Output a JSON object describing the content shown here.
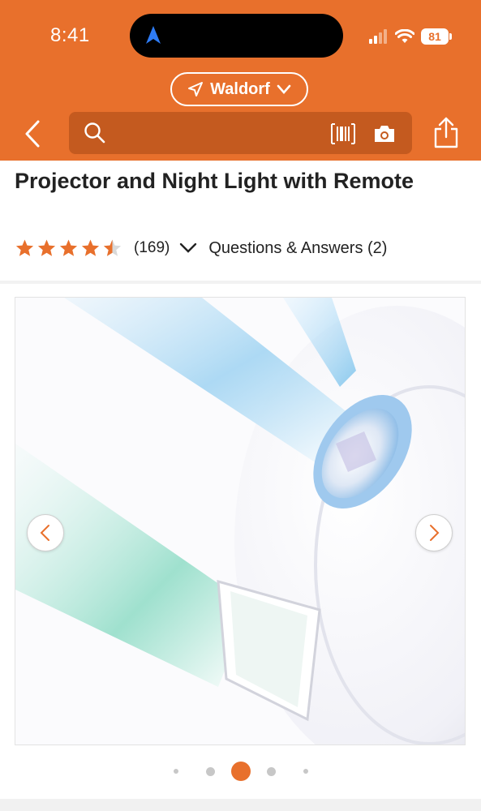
{
  "status_bar": {
    "time": "8:41",
    "battery": "81",
    "icons": [
      "location-arrow-icon",
      "signal-icon",
      "wifi-icon",
      "battery-icon"
    ]
  },
  "header": {
    "store_name": "Waldorf",
    "search_placeholder": "",
    "background_color": "#e8702c",
    "search_bg_color": "#c45a1f",
    "icons": [
      "back-arrow-icon",
      "search-icon",
      "barcode-icon",
      "camera-icon",
      "share-icon"
    ]
  },
  "product": {
    "title": "Projector and Night Light with Remote",
    "rating_value": 4.5,
    "rating_max": 5,
    "review_count": "(169)",
    "qa_label": "Questions & Answers (2)",
    "star_color": "#e8702c"
  },
  "gallery": {
    "prev_icon": "chevron-left-icon",
    "next_icon": "chevron-right-icon",
    "active_index": 2,
    "dot_count": 5,
    "active_color": "#e8702c"
  }
}
